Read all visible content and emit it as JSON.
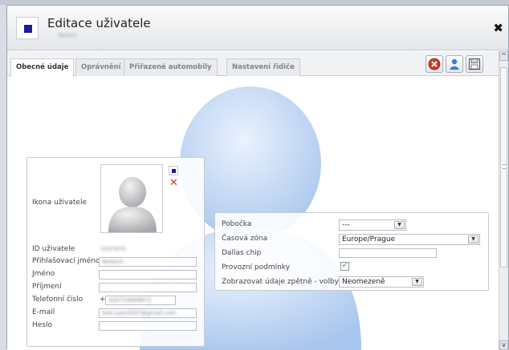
{
  "dialog": {
    "title": "Editace uživatele",
    "subtitle": "Neitech"
  },
  "tabs": [
    {
      "label": "Obecné údaje",
      "active": true
    },
    {
      "label": "Oprávnění",
      "active": false
    },
    {
      "label": "Přiřazené automobily",
      "active": false
    },
    {
      "label": "Nastavení řidiče",
      "active": false
    }
  ],
  "toolbar_icons": [
    "delete-icon",
    "user-icon",
    "save-icon"
  ],
  "colors": {
    "accent": "#20189a",
    "danger": "#d03a2a",
    "user_blue": "#3a7ed4"
  },
  "user_panel": {
    "icon_label": "Ikona uživatele",
    "fields": [
      {
        "label": "ID uživatele",
        "value": "1537970"
      },
      {
        "label": "Přihlašovací jméno",
        "value": "Neitech"
      },
      {
        "label": "Jméno",
        "value": ""
      },
      {
        "label": "Příjmení",
        "value": ""
      },
      {
        "label": "Telefonní číslo",
        "prefix": "+",
        "value": "420733669872"
      },
      {
        "label": "E-mail",
        "value": "test.user3357@gmail.com"
      },
      {
        "label": "Heslo",
        "value": ""
      }
    ]
  },
  "settings_panel": {
    "rows": [
      {
        "label": "Pobočka",
        "value": "---"
      },
      {
        "label": "Časová zóna",
        "value": "Europe/Prague"
      },
      {
        "label": "Dallas chip",
        "value": ""
      },
      {
        "label": "Provozní podmínky",
        "checked": true
      },
      {
        "label": "Zobrazovat údaje zpětně - volby",
        "value": "Neomezeně"
      }
    ]
  },
  "scrollbar": {
    "up": "^",
    "down": "v"
  }
}
